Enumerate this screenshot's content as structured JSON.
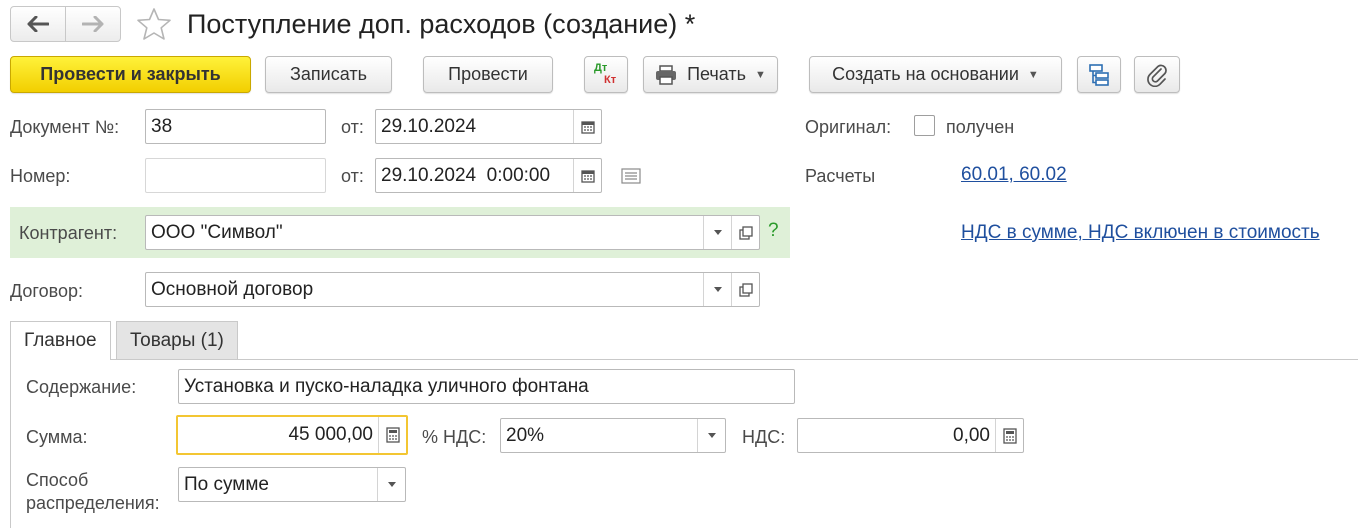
{
  "window": {
    "title": "Поступление доп. расходов (создание) *"
  },
  "toolbar": {
    "post_close": "Провести и закрыть",
    "save": "Записать",
    "post": "Провести",
    "dt_label": "Дт",
    "kt_label": "Кт",
    "print": "Печать",
    "create_based": "Создать на основании"
  },
  "form": {
    "doc_no_label": "Документ №:",
    "doc_no": "38",
    "from_label": "от:",
    "doc_date": "29.10.2024",
    "number_label": "Номер:",
    "number": "",
    "number_date": "29.10.2024  0:00:00",
    "original_label": "Оригинал:",
    "received_label": "получен",
    "received_checked": false,
    "accounts_label": "Расчеты",
    "accounts_link": "60.01, 60.02",
    "counterparty_label": "Контрагент:",
    "counterparty": "ООО \"Символ\"",
    "help_mark": "?",
    "vat_link": "НДС в сумме, НДС включен в стоимость",
    "contract_label": "Договор:",
    "contract": "Основной договор"
  },
  "tabs": [
    {
      "label": "Главное",
      "active": true
    },
    {
      "label": "Товары (1)",
      "active": false
    }
  ],
  "main_tab": {
    "content_label": "Содержание:",
    "content": "Установка и пуско-наладка уличного фонтана",
    "sum_label": "Сумма:",
    "sum": "45 000,00",
    "vat_rate_label": "% НДС:",
    "vat_rate": "20%",
    "vat_label": "НДС:",
    "vat": "0,00",
    "distribution_label_1": "Способ",
    "distribution_label_2": "распределения:",
    "distribution": "По сумме"
  },
  "colors": {
    "primary_button": "#f7dc1c",
    "counterparty_highlight": "#dff0d8",
    "link": "#1f4f9e",
    "focus_border": "#f3c632"
  }
}
